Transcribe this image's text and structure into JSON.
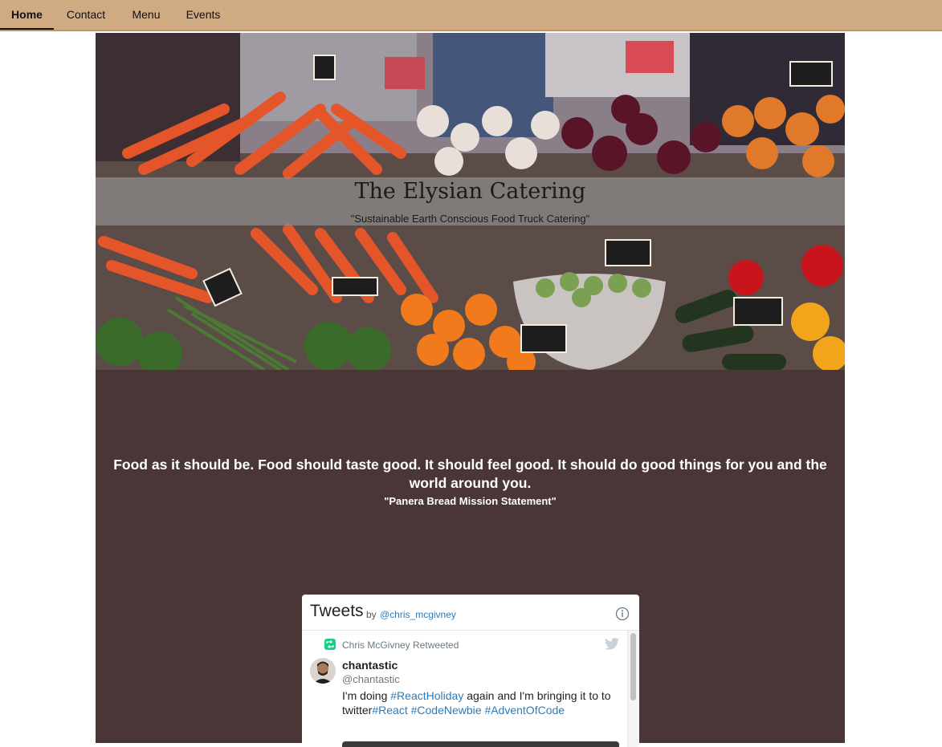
{
  "nav": {
    "items": [
      {
        "label": "Home",
        "active": true
      },
      {
        "label": "Contact",
        "active": false
      },
      {
        "label": "Menu",
        "active": false
      },
      {
        "label": "Events",
        "active": false
      }
    ]
  },
  "hero": {
    "title": "The Elysian Catering",
    "subtitle": "\"Sustainable Earth Conscious Food Truck Catering\""
  },
  "mission": {
    "quote": "Food as it should be. Food should taste good. It should feel good. It should do good things for you and the world around you.",
    "attribution": "\"Panera Bread Mission Statement\""
  },
  "tweets": {
    "title": "Tweets",
    "by": "by",
    "handle": "@chris_mcgivney",
    "retweeted_by": "Chris McGivney Retweeted",
    "author_name": "chantastic",
    "author_handle": "@chantastic",
    "text_1": "I'm doing ",
    "tag_react_holiday": "#ReactHoliday",
    "text_2": " again and I'm bringing it to to twitter",
    "tag_react": "#React",
    "tag_code_newbie": "#CodeNewbie",
    "tag_advent": "#AdventOfCode"
  },
  "colors": {
    "nav_bg": "#d0aa80",
    "mission_bg": "#4a3637",
    "link": "#2b7bb9",
    "retweet_green": "#19cf86"
  },
  "icons": [
    "info-icon",
    "retweet-icon",
    "twitter-bird-icon"
  ]
}
